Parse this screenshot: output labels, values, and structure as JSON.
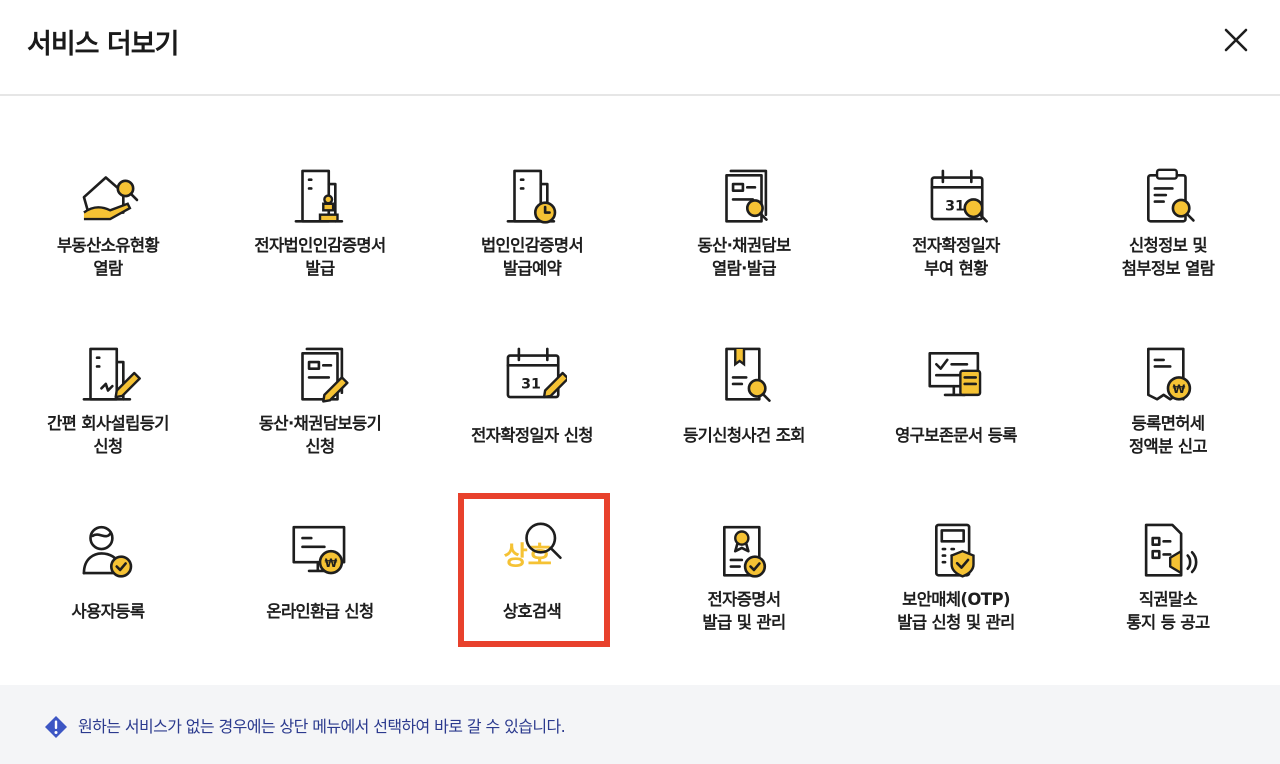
{
  "header": {
    "title": "서비스 더보기"
  },
  "colors": {
    "accent": "#f5c234",
    "outline": "#1e1e1e",
    "highlight": "#e8412c",
    "notice": "#2b3a8e"
  },
  "tiles": [
    {
      "name": "real-estate-ownership",
      "icon": "house-search-icon",
      "lines": [
        "부동산소유현황",
        "열람"
      ]
    },
    {
      "name": "corporate-seal-cert",
      "icon": "building-stamp-icon",
      "lines": [
        "전자법인인감증명서",
        "발급"
      ]
    },
    {
      "name": "seal-cert-reservation",
      "icon": "building-clock-icon",
      "lines": [
        "법인인감증명서",
        "발급예약"
      ]
    },
    {
      "name": "movable-collateral-view",
      "icon": "document-search-icon",
      "lines": [
        "동산·채권담보",
        "열람·발급"
      ]
    },
    {
      "name": "fixed-date-status",
      "icon": "calendar-search-icon",
      "lines": [
        "전자확정일자",
        "부여 현황"
      ]
    },
    {
      "name": "application-info-view",
      "icon": "clipboard-search-icon",
      "lines": [
        "신청정보 및",
        "첨부정보 열람"
      ]
    },
    {
      "name": "simple-incorporation",
      "icon": "building-pen-icon",
      "lines": [
        "간편 회사설립등기",
        "신청"
      ]
    },
    {
      "name": "movable-collateral-registration",
      "icon": "document-pen-icon",
      "lines": [
        "동산·채권담보등기",
        "신청"
      ]
    },
    {
      "name": "fixed-date-application",
      "icon": "calendar-pen-icon",
      "lines": [
        "전자확정일자 신청"
      ]
    },
    {
      "name": "registration-case-lookup",
      "icon": "bookmark-search-icon",
      "lines": [
        "등기신청사건 조회"
      ]
    },
    {
      "name": "permanent-document-registration",
      "icon": "monitor-scroll-icon",
      "lines": [
        "영구보존문서 등록"
      ]
    },
    {
      "name": "registration-license-tax",
      "icon": "receipt-won-icon",
      "lines": [
        "등록면허세",
        "정액분 신고"
      ]
    },
    {
      "name": "user-registration",
      "icon": "user-check-icon",
      "lines": [
        "사용자등록"
      ]
    },
    {
      "name": "online-refund",
      "icon": "monitor-won-icon",
      "lines": [
        "온라인환급 신청"
      ]
    },
    {
      "name": "trade-name-search",
      "icon": "trade-name-search-icon",
      "icon_text": "상호",
      "lines": [
        "상호검색"
      ]
    },
    {
      "name": "e-certificate",
      "icon": "certificate-check-icon",
      "lines": [
        "전자증명서",
        "발급 및 관리"
      ]
    },
    {
      "name": "security-otp",
      "icon": "otp-shield-icon",
      "lines": [
        "보안매체(OTP)",
        "발급 신청 및 관리"
      ]
    },
    {
      "name": "dismissal-notice",
      "icon": "document-megaphone-icon",
      "lines": [
        "직권말소",
        "통지 등 공고"
      ]
    }
  ],
  "footer": {
    "icon": "exclamation-diamond-icon",
    "notice": "원하는 서비스가 없는 경우에는 상단 메뉴에서 선택하여 바로 갈 수 있습니다."
  }
}
